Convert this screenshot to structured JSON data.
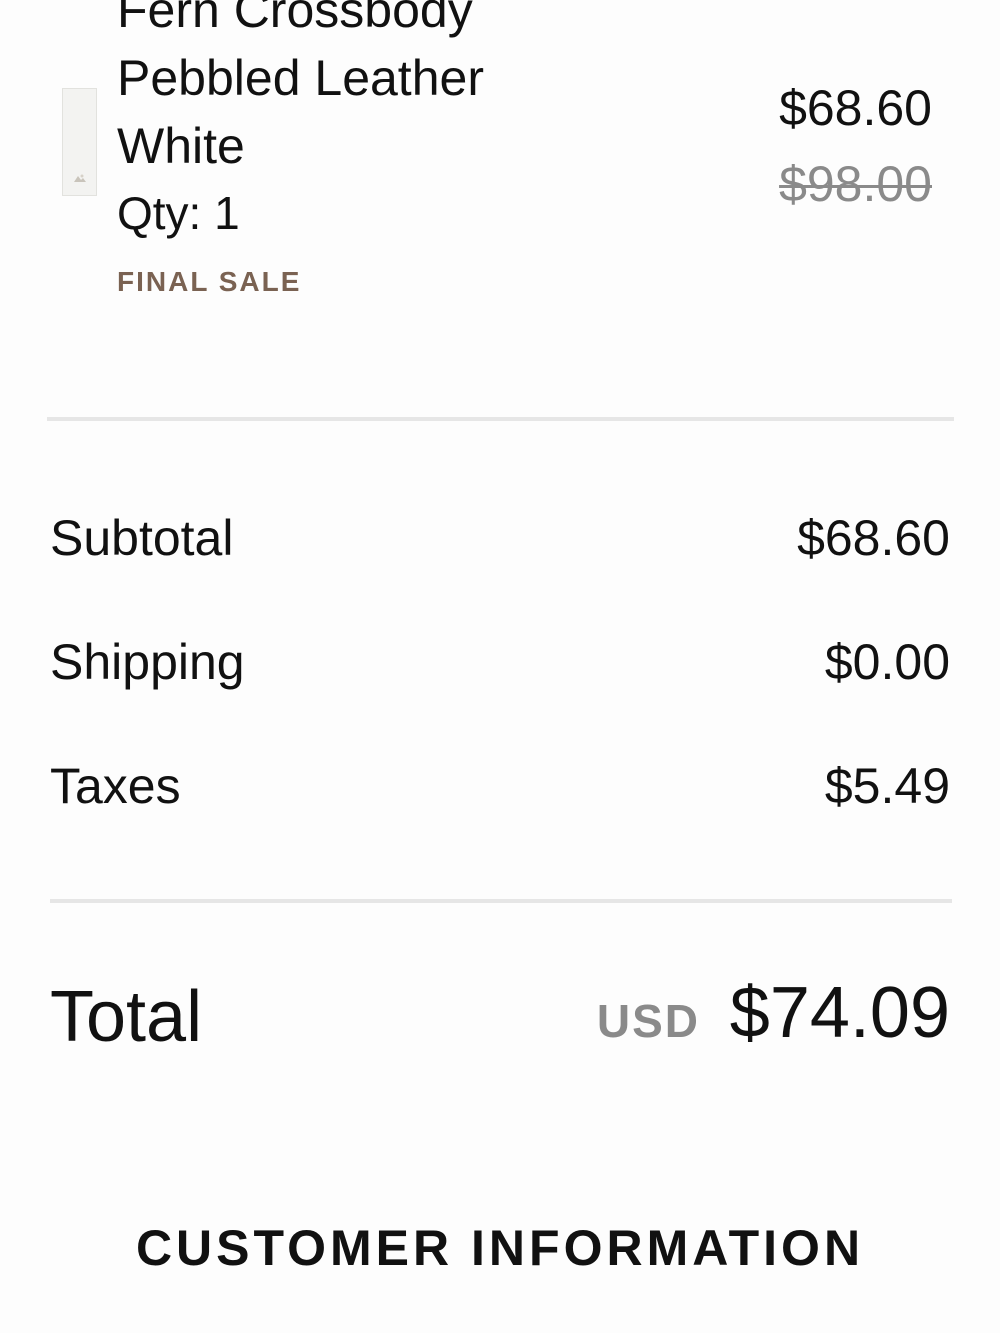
{
  "order_item": {
    "name": "Fern Crossbody Pebbled Leather White",
    "quantity": "Qty: 1",
    "badge": "FINAL SALE",
    "price_current": "$68.60",
    "price_original": "$98.00",
    "thumbnail_icon": "product-thumbnail"
  },
  "summary": {
    "subtotal_label": "Subtotal",
    "subtotal_value": "$68.60",
    "shipping_label": "Shipping",
    "shipping_value": "$0.00",
    "taxes_label": "Taxes",
    "taxes_value": "$5.49"
  },
  "total": {
    "label": "Total",
    "currency": "USD",
    "amount": "$74.09"
  },
  "customer_section": {
    "heading": "CUSTOMER INFORMATION"
  },
  "colors": {
    "text": "#111111",
    "muted": "#8a8a8a",
    "final_sale": "#7a6252",
    "divider": "#e6e6e6"
  }
}
